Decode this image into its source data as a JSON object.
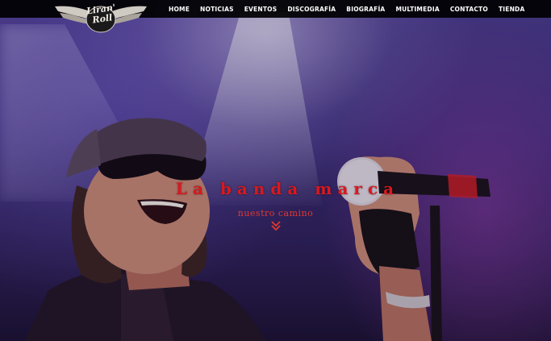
{
  "brand": {
    "logo_text_top": "Liran'",
    "logo_text_bottom": "Roll"
  },
  "nav": {
    "items": [
      {
        "label": "HOME"
      },
      {
        "label": "NOTICIAS"
      },
      {
        "label": "EVENTOS"
      },
      {
        "label": "DISCOGRAFÍA"
      },
      {
        "label": "BIOGRAFÍA"
      },
      {
        "label": "MULTIMEDIA"
      },
      {
        "label": "CONTACTO"
      },
      {
        "label": "TIENDA"
      }
    ]
  },
  "hero": {
    "headline": "La banda marca",
    "subline": "nuestro camino",
    "scroll_icon": "double-chevron-down-icon"
  },
  "colors": {
    "accent_red": "#d8191f",
    "nav_background": "#000000",
    "nav_text": "#ffffff",
    "stage_purple": "#3d2f7c"
  }
}
